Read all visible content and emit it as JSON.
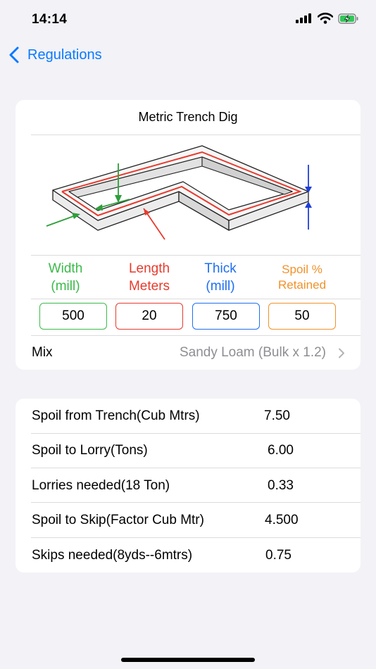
{
  "status": {
    "time": "14:14"
  },
  "nav": {
    "back_label": "Regulations"
  },
  "trench": {
    "title": "Metric Trench Dig",
    "fields": [
      {
        "label_line1": "Width",
        "label_line2": "(mill)",
        "value": "500",
        "color": "#3cba4a"
      },
      {
        "label_line1": "Length",
        "label_line2": "Meters",
        "value": "20",
        "color": "#e63b2e"
      },
      {
        "label_line1": "Thick",
        "label_line2": "(mill)",
        "value": "750",
        "color": "#1f6ff0"
      },
      {
        "label_line1": "Spoil %",
        "label_line2": "Retained",
        "value": "50",
        "color": "#f0922a"
      }
    ],
    "mix": {
      "label": "Mix",
      "value": "Sandy Loam (Bulk x 1.2)"
    }
  },
  "results": [
    {
      "label": "Spoil from Trench(Cub Mtrs)",
      "value": "7.50"
    },
    {
      "label": "Spoil to Lorry(Tons)",
      "value": "6.00"
    },
    {
      "label": "Lorries needed(18 Ton)",
      "value": "0.33"
    },
    {
      "label": "Spoil to Skip(Factor Cub Mtr)",
      "value": "4.500"
    },
    {
      "label": "Skips needed(8yds--6mtrs)",
      "value": "0.75"
    }
  ],
  "colors": {
    "accent": "#0a7aff",
    "secondary_text": "#8e8e93",
    "background": "#f2f2f7"
  },
  "icons": {
    "back": "chevron-left-icon",
    "mix": "chevron-right-icon",
    "signal": "signal-icon",
    "wifi": "wifi-icon",
    "battery": "battery-charging-icon"
  }
}
